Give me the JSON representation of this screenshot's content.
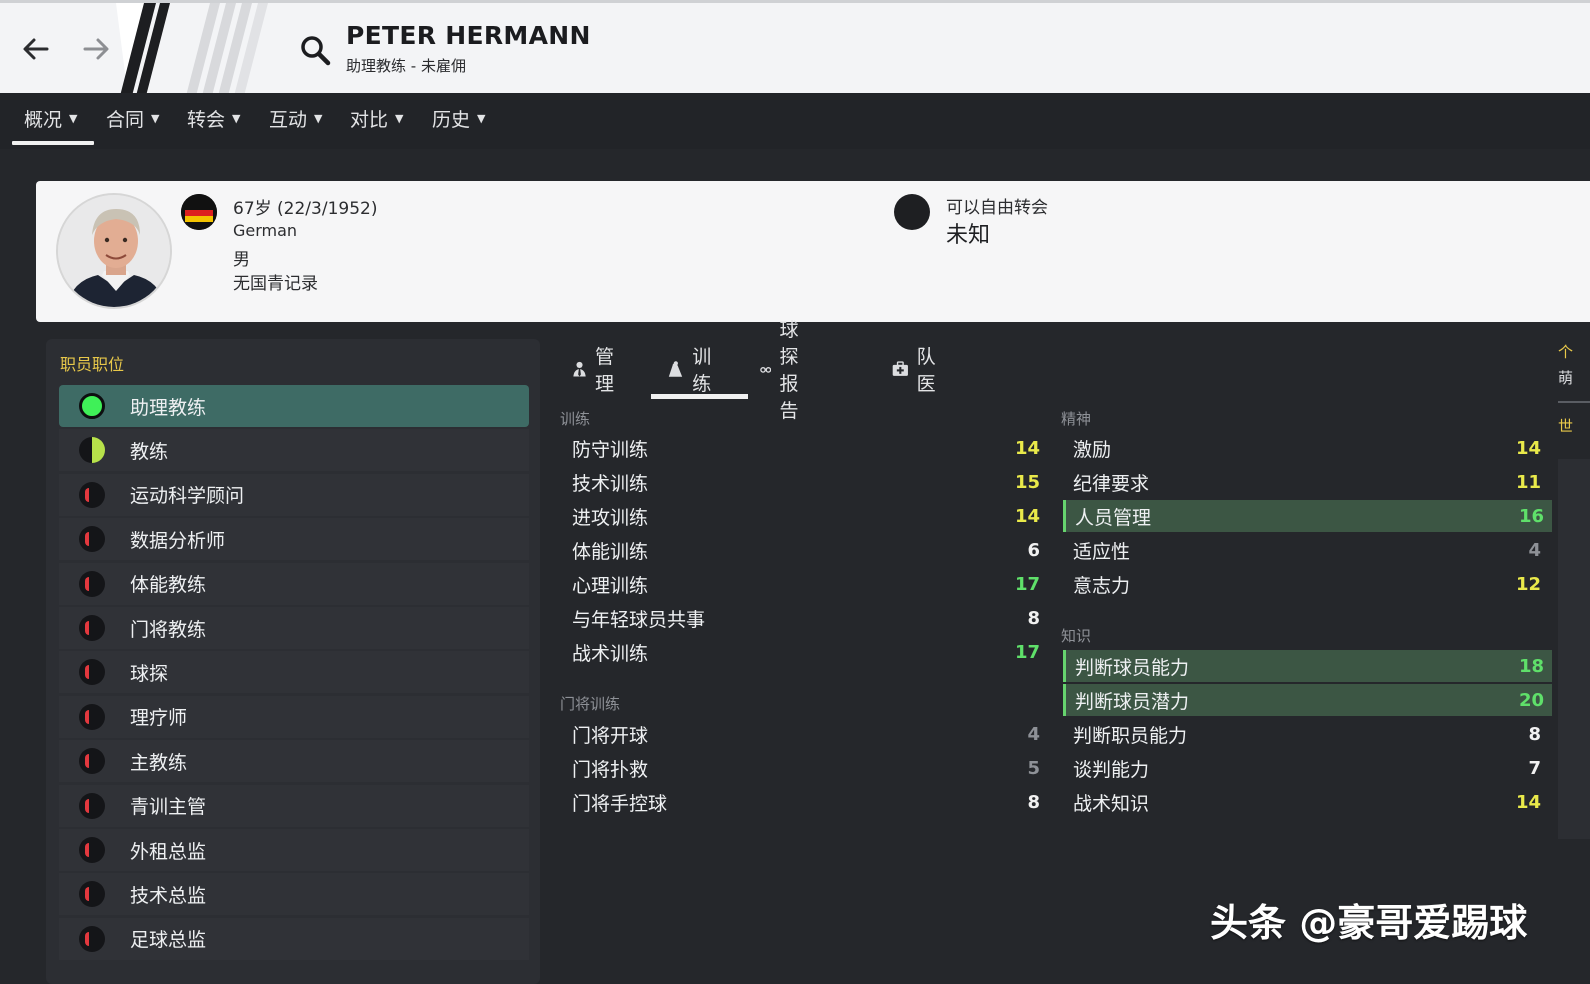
{
  "header": {
    "name": "PETER HERMANN",
    "role_status": "助理教练 - 未雇佣"
  },
  "nav": {
    "tabs": [
      {
        "label": "概况"
      },
      {
        "label": "合同"
      },
      {
        "label": "转会"
      },
      {
        "label": "互动"
      },
      {
        "label": "对比"
      },
      {
        "label": "历史"
      }
    ],
    "active_index": 0
  },
  "profile": {
    "age_dob": "67岁 (22/3/1952)",
    "nationality": "German",
    "gender": "男",
    "youth_record": "无国青记录",
    "transfer_label": "可以自由转会",
    "transfer_value": "未知"
  },
  "roles": {
    "title": "职员职位",
    "items": [
      {
        "label": "助理教练",
        "rating": "full",
        "active": true
      },
      {
        "label": "教练",
        "rating": "half",
        "active": false
      },
      {
        "label": "运动科学顾问",
        "rating": "low",
        "active": false
      },
      {
        "label": "数据分析师",
        "rating": "low",
        "active": false
      },
      {
        "label": "体能教练",
        "rating": "low",
        "active": false
      },
      {
        "label": "门将教练",
        "rating": "low",
        "active": false
      },
      {
        "label": "球探",
        "rating": "low",
        "active": false
      },
      {
        "label": "理疗师",
        "rating": "low",
        "active": false
      },
      {
        "label": "主教练",
        "rating": "low",
        "active": false
      },
      {
        "label": "青训主管",
        "rating": "low",
        "active": false
      },
      {
        "label": "外租总监",
        "rating": "low",
        "active": false
      },
      {
        "label": "技术总监",
        "rating": "low",
        "active": false
      },
      {
        "label": "足球总监",
        "rating": "low",
        "active": false
      }
    ]
  },
  "attr_tabs": [
    {
      "label": "管理",
      "icon": "manager-icon"
    },
    {
      "label": "训练",
      "icon": "training-icon"
    },
    {
      "label": "球探报告",
      "icon": "binoculars-icon"
    },
    {
      "label": "队医",
      "icon": "medical-kit-icon"
    }
  ],
  "attributes": {
    "training": {
      "title": "训练",
      "items": [
        {
          "label": "防守训练",
          "value": "14",
          "color": "yellow"
        },
        {
          "label": "技术训练",
          "value": "15",
          "color": "yellow"
        },
        {
          "label": "进攻训练",
          "value": "14",
          "color": "yellow"
        },
        {
          "label": "体能训练",
          "value": "6",
          "color": "white"
        },
        {
          "label": "心理训练",
          "value": "17",
          "color": "green"
        },
        {
          "label": "与年轻球员共事",
          "value": "8",
          "color": "white"
        },
        {
          "label": "战术训练",
          "value": "17",
          "color": "green"
        }
      ]
    },
    "goalkeeping": {
      "title": "门将训练",
      "items": [
        {
          "label": "门将开球",
          "value": "4",
          "color": "gray"
        },
        {
          "label": "门将扑救",
          "value": "5",
          "color": "gray"
        },
        {
          "label": "门将手控球",
          "value": "8",
          "color": "white"
        }
      ]
    },
    "mental": {
      "title": "精神",
      "items": [
        {
          "label": "激励",
          "value": "14",
          "color": "yellow",
          "highlight": false
        },
        {
          "label": "纪律要求",
          "value": "11",
          "color": "yellow",
          "highlight": false
        },
        {
          "label": "人员管理",
          "value": "16",
          "color": "green",
          "highlight": true
        },
        {
          "label": "适应性",
          "value": "4",
          "color": "gray",
          "highlight": false
        },
        {
          "label": "意志力",
          "value": "12",
          "color": "yellow",
          "highlight": false
        }
      ]
    },
    "knowledge": {
      "title": "知识",
      "items": [
        {
          "label": "判断球员能力",
          "value": "18",
          "color": "green",
          "highlight": true
        },
        {
          "label": "判断球员潜力",
          "value": "20",
          "color": "green",
          "highlight": true
        },
        {
          "label": "判断职员能力",
          "value": "8",
          "color": "white",
          "highlight": false
        },
        {
          "label": "谈判能力",
          "value": "7",
          "color": "white",
          "highlight": false
        },
        {
          "label": "战术知识",
          "value": "14",
          "color": "yellow",
          "highlight": false
        }
      ]
    }
  },
  "right_edge": {
    "chars": [
      "个",
      "萌",
      "世"
    ]
  },
  "watermark": "头条 @豪哥爱踢球",
  "colors": {
    "accent_green": "#5fe06a",
    "accent_yellow": "#e9e94a",
    "role_title": "#e8c84a",
    "active_role_bg": "#3e6b65"
  }
}
